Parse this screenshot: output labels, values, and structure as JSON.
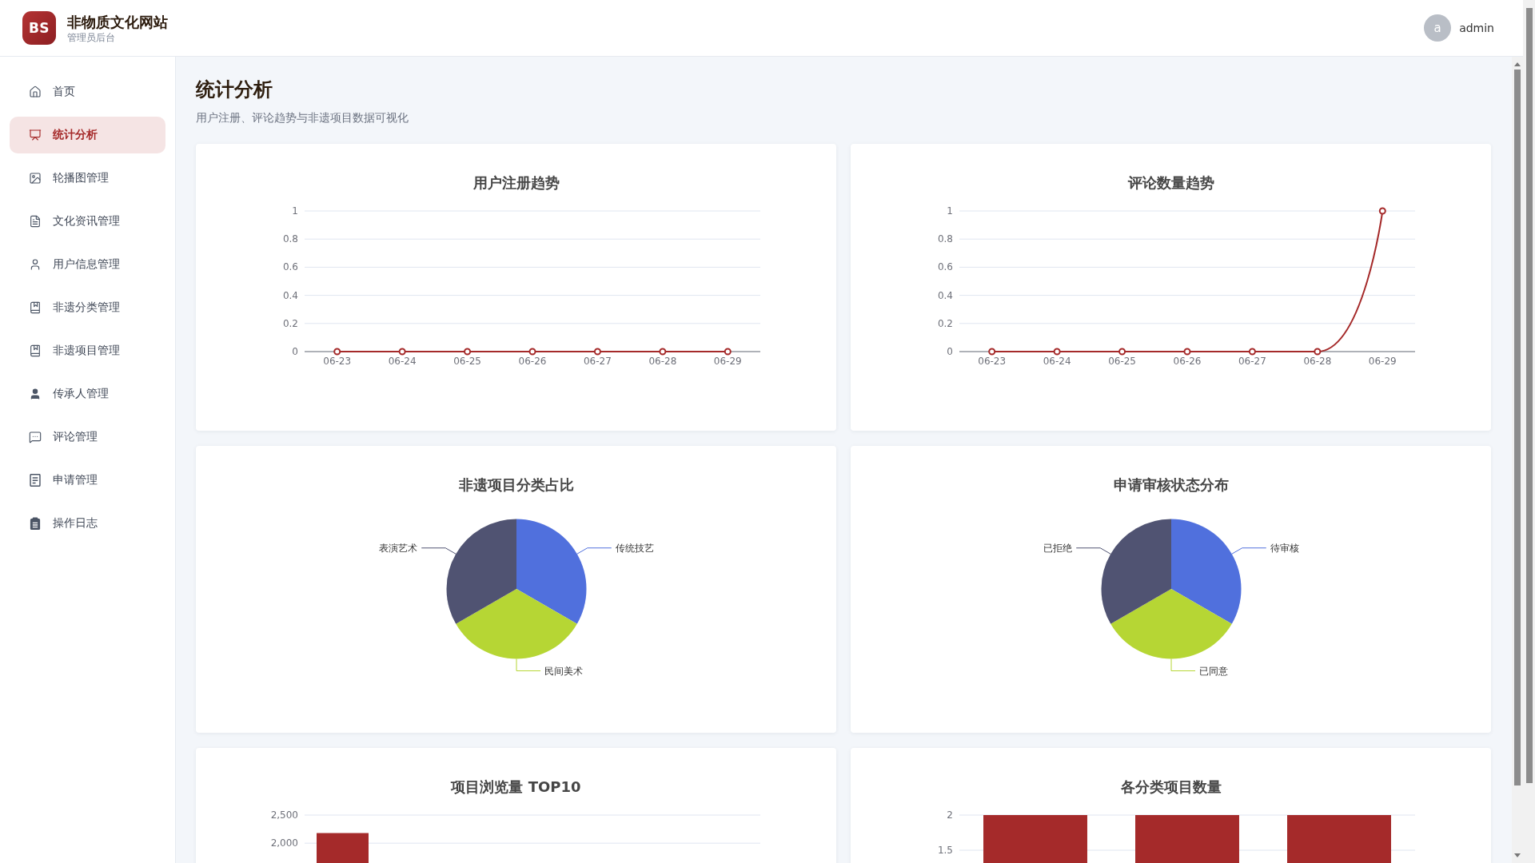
{
  "header": {
    "logo": "BS",
    "title": "非物质文化网站",
    "subtitle": "管理员后台",
    "user": {
      "avatar": "a",
      "name": "admin"
    }
  },
  "sidebar": {
    "items": [
      {
        "label": "首页",
        "selected": false
      },
      {
        "label": "统计分析",
        "selected": true
      },
      {
        "label": "轮播图管理",
        "selected": false
      },
      {
        "label": "文化资讯管理",
        "selected": false
      },
      {
        "label": "用户信息管理",
        "selected": false
      },
      {
        "label": "非遗分类管理",
        "selected": false
      },
      {
        "label": "非遗项目管理",
        "selected": false
      },
      {
        "label": "传承人管理",
        "selected": false
      },
      {
        "label": "评论管理",
        "selected": false
      },
      {
        "label": "申请管理",
        "selected": false
      },
      {
        "label": "操作日志",
        "selected": false
      }
    ]
  },
  "page": {
    "title": "统计分析",
    "subtitle": "用户注册、评论趋势与非遗项目数据可视化"
  },
  "charts": [
    {
      "chart_data": {
        "type": "line",
        "title": "用户注册趋势",
        "categories": [
          "06-23",
          "06-24",
          "06-25",
          "06-26",
          "06-27",
          "06-28",
          "06-29"
        ],
        "values": [
          0,
          0,
          0,
          0,
          0,
          0,
          0
        ],
        "ylim": [
          0,
          1
        ],
        "yticks": [
          0,
          0.2,
          0.4,
          0.6,
          0.8,
          1
        ],
        "grid": true,
        "marker": true
      }
    },
    {
      "chart_data": {
        "type": "line",
        "title": "评论数量趋势",
        "categories": [
          "06-23",
          "06-24",
          "06-25",
          "06-26",
          "06-27",
          "06-28",
          "06-29"
        ],
        "values": [
          0,
          0,
          0,
          0,
          0,
          0,
          1
        ],
        "ylim": [
          0,
          1
        ],
        "yticks": [
          0,
          0.2,
          0.4,
          0.6,
          0.8,
          1
        ],
        "grid": true,
        "marker": true
      }
    },
    {
      "chart_data": {
        "type": "pie",
        "title": "非遗项目分类占比",
        "categories": [
          "传统技艺",
          "民间美术",
          "表演艺术"
        ],
        "values": [
          33.33,
          33.33,
          33.34
        ]
      }
    },
    {
      "chart_data": {
        "type": "pie",
        "title": "申请审核状态分布",
        "categories": [
          "待审核",
          "已同意",
          "已拒绝"
        ],
        "values": [
          33.33,
          33.33,
          33.34
        ]
      }
    },
    {
      "chart_data": {
        "type": "bar",
        "title": "项目浏览量 TOP10",
        "values": [
          2180
        ],
        "ylim": [
          0,
          2500
        ],
        "yticks": [
          {
            "value": 2000,
            "label": "2,000"
          },
          {
            "value": 2500,
            "label": "2,500"
          }
        ],
        "grid": true
      }
    },
    {
      "chart_data": {
        "type": "bar",
        "title": "各分类项目数量",
        "values": [
          2,
          2,
          2
        ],
        "ylim": [
          0,
          2
        ],
        "yticks": [
          1.5,
          2
        ],
        "grid": true
      }
    }
  ]
}
